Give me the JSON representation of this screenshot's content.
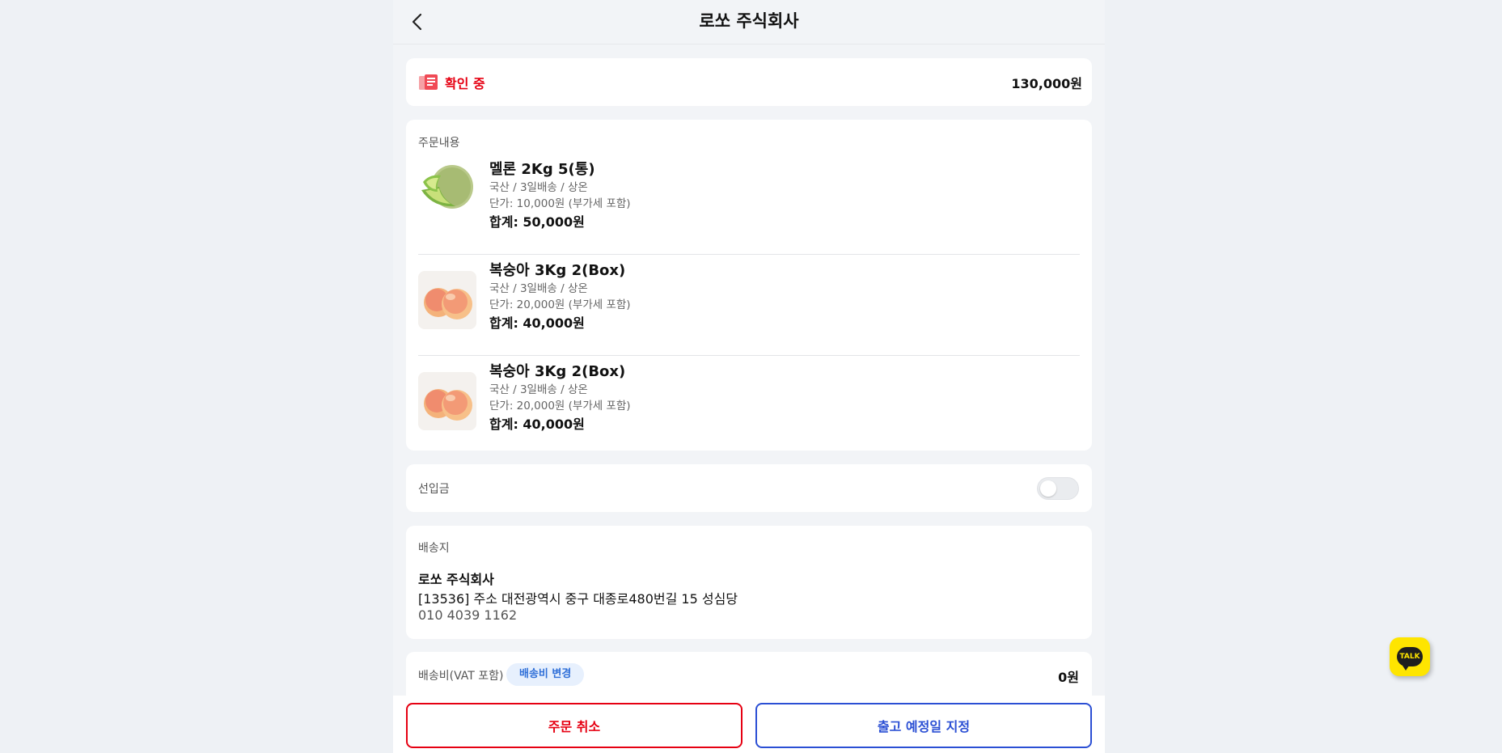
{
  "header": {
    "title": "로쏘 주식회사"
  },
  "status": {
    "label": "확인 중",
    "total": "130,000원",
    "color": "#e60012"
  },
  "order": {
    "section_label": "주문내용",
    "items": [
      {
        "name": "멜론 2Kg 5(통)",
        "meta1": "국산 / 3일배송 / 상온",
        "meta2": "단가: 10,000원 (부가세 포함)",
        "sum": "합계: 50,000원",
        "icon": "melon-icon"
      },
      {
        "name": "복숭아 3Kg 2(Box)",
        "meta1": "국산 / 3일배송 / 상온",
        "meta2": "단가: 20,000원 (부가세 포함)",
        "sum": "합계: 40,000원",
        "icon": "peach-icon"
      },
      {
        "name": "복숭아 3Kg 2(Box)",
        "meta1": "국산 / 3일배송 / 상온",
        "meta2": "단가: 20,000원 (부가세 포함)",
        "sum": "합계: 40,000원",
        "icon": "peach-icon"
      }
    ]
  },
  "prepay": {
    "label": "선입금",
    "enabled": false
  },
  "address": {
    "section_label": "배송지",
    "name": "로쏘 주식회사",
    "line": "[13536] 주소 대전광역시 중구 대종로480번길 15 성심당",
    "phone": "010 4039 1162"
  },
  "shipping": {
    "label": "배송비(VAT 포함)",
    "badge": "배송비 변경",
    "fee": "0원"
  },
  "actions": {
    "cancel_label": "주문 취소",
    "schedule_label": "출고 예정일 지정",
    "cancel_color": "#e60012",
    "schedule_color": "#2b4fd4"
  },
  "chat": {
    "label": "TALK",
    "color": "#fee500"
  }
}
